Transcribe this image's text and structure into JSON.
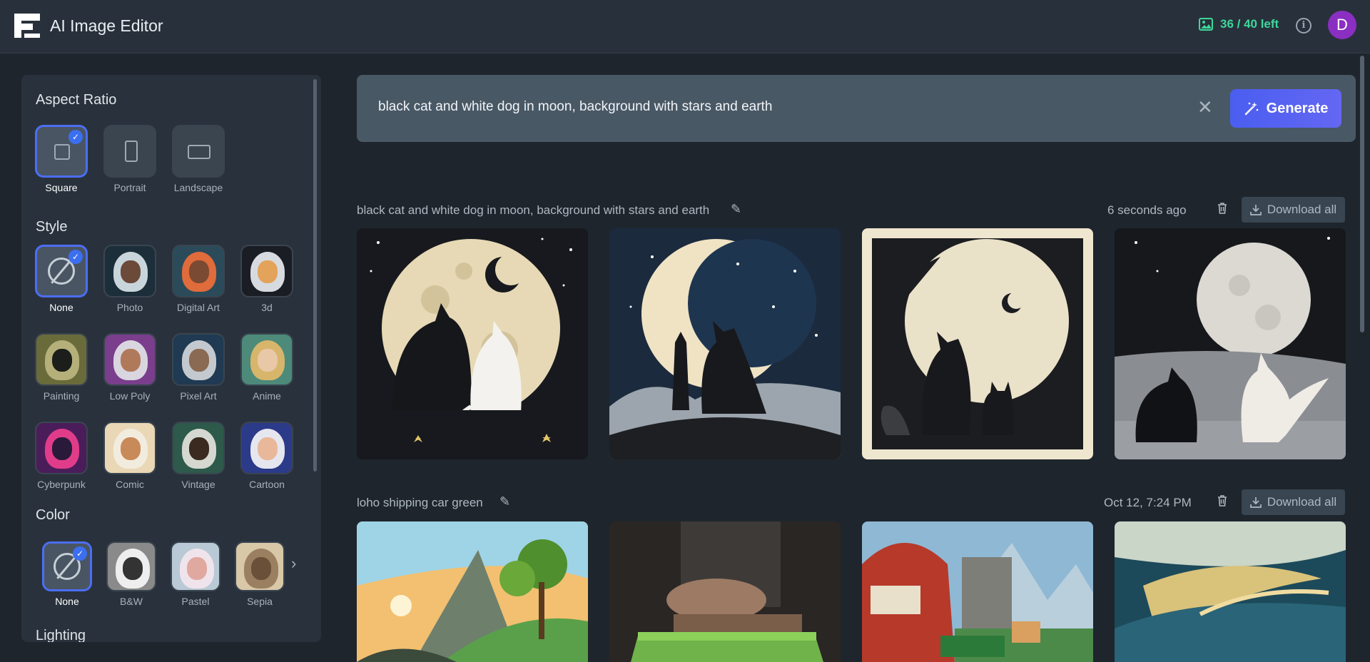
{
  "header": {
    "app_title": "AI Image Editor",
    "credits_text": "36 / 40 left",
    "avatar_initial": "D",
    "info_icon": "info-icon",
    "accent_color": "#3dd89a"
  },
  "sidebar": {
    "aspect_ratio": {
      "title": "Aspect Ratio",
      "options": [
        {
          "label": "Square",
          "selected": true
        },
        {
          "label": "Portrait",
          "selected": false
        },
        {
          "label": "Landscape",
          "selected": false
        }
      ]
    },
    "style": {
      "title": "Style",
      "options": [
        {
          "label": "None",
          "selected": true
        },
        {
          "label": "Photo"
        },
        {
          "label": "Digital Art"
        },
        {
          "label": "3d"
        },
        {
          "label": "Painting"
        },
        {
          "label": "Low Poly"
        },
        {
          "label": "Pixel Art"
        },
        {
          "label": "Anime"
        },
        {
          "label": "Cyberpunk"
        },
        {
          "label": "Comic"
        },
        {
          "label": "Vintage"
        },
        {
          "label": "Cartoon"
        }
      ]
    },
    "color": {
      "title": "Color",
      "options": [
        {
          "label": "None",
          "selected": true
        },
        {
          "label": "B&W"
        },
        {
          "label": "Pastel"
        },
        {
          "label": "Sepia"
        }
      ]
    },
    "lighting": {
      "title": "Lighting"
    }
  },
  "search": {
    "value": "black cat and white dog in moon, background with stars and earth",
    "generate_label": "Generate"
  },
  "generations": [
    {
      "prompt": "black cat and white dog in moon, background with stars and earth",
      "time": "6 seconds ago",
      "download_label": "Download all"
    },
    {
      "prompt": "loho shipping car green",
      "time": "Oct 12, 7:24 PM",
      "download_label": "Download all"
    }
  ]
}
